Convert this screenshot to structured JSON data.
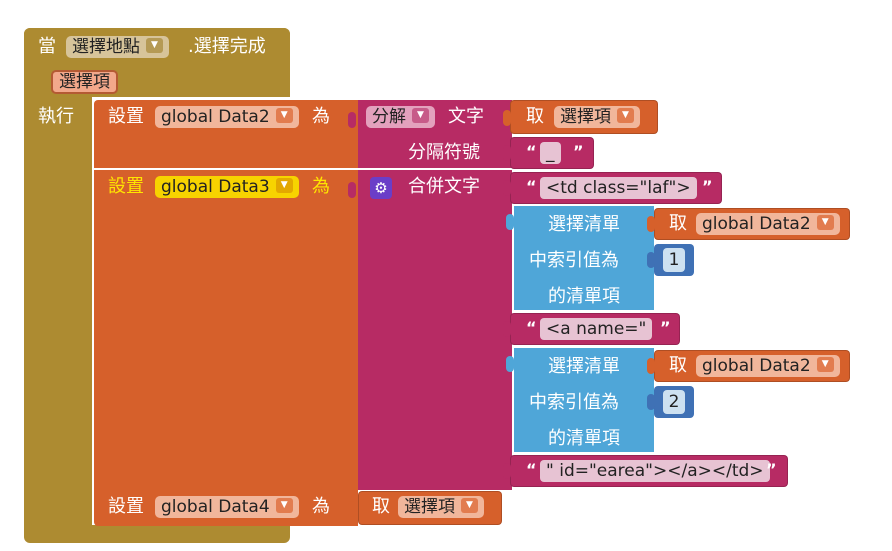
{
  "event": {
    "when": "當",
    "component": "選擇地點",
    "event_name": ".選擇完成",
    "param": "選擇項",
    "do": "執行"
  },
  "set_to": {
    "set": "設置",
    "to": "為"
  },
  "block1": {
    "variable": "global Data2",
    "split": "分解",
    "text": "文字",
    "get": "取",
    "get_var": "選擇項",
    "separator_label": "分隔符號",
    "separator_value": "_"
  },
  "block2": {
    "variable": "global Data3",
    "join": "合併文字",
    "str1": "<td class=\"laf\">",
    "str2": "<a name=\"",
    "str3": "\" id=\"earea\"></a></td>"
  },
  "select_item": {
    "label1": "選擇清單",
    "label2": "中索引值為",
    "label3": "的清單項",
    "get": "取",
    "list": "global Data2",
    "index1": "1",
    "index2": "2"
  },
  "block3": {
    "variable": "global Data4",
    "get": "取",
    "get_var": "選擇項"
  },
  "quote_char": "“",
  "quote_close": "”",
  "colors": {
    "event": "#ad8b31",
    "set": "#d6602b",
    "text": "#b72b64",
    "list": "#4fa6d8",
    "yellow_highlight": "#ffe600"
  },
  "icons": [
    "dropdown-arrow-icon",
    "gear-icon"
  ]
}
